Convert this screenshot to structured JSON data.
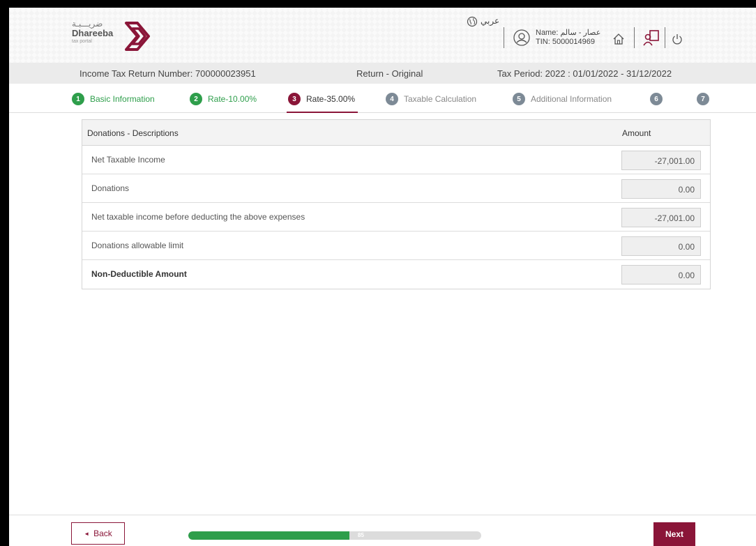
{
  "brand": {
    "name_ar": "ضريـــبـة",
    "name_en": "Dhareeba",
    "tagline": "tax portal",
    "color": "#8a1538"
  },
  "header": {
    "language_toggle": "عربي",
    "user_name": "Name: عصار - سالم",
    "tin": "TIN: 5000014969"
  },
  "info": {
    "return_number": "Income Tax Return Number: 700000023951",
    "return_type": "Return - Original",
    "tax_period": "Tax Period: 2022 : 01/01/2022 - 31/12/2022"
  },
  "steps": [
    {
      "num": "1",
      "label": "Basic Information",
      "state": "done"
    },
    {
      "num": "2",
      "label": "Rate-10.00%",
      "state": "done"
    },
    {
      "num": "3",
      "label": "Rate-35.00%",
      "state": "active"
    },
    {
      "num": "4",
      "label": "Taxable Calculation",
      "state": "todo"
    },
    {
      "num": "5",
      "label": "Additional Information",
      "state": "todo"
    },
    {
      "num": "6",
      "label": "",
      "state": "todo"
    },
    {
      "num": "7",
      "label": "",
      "state": "todo"
    }
  ],
  "table": {
    "col_description": "Donations - Descriptions",
    "col_amount": "Amount",
    "rows": [
      {
        "label": "Net Taxable Income",
        "amount": "-27,001.00"
      },
      {
        "label": "Donations",
        "amount": "0.00"
      },
      {
        "label": "Net taxable income before deducting the above expenses",
        "amount": "-27,001.00"
      },
      {
        "label": "Donations allowable limit",
        "amount": "0.00"
      },
      {
        "label": "Non-Deductible Amount",
        "amount": "0.00"
      }
    ]
  },
  "footer": {
    "back_label": "Back",
    "next_label": "Next",
    "progress_value": "85",
    "progress_percent": 55,
    "progress_color": "#2e9e4b"
  }
}
